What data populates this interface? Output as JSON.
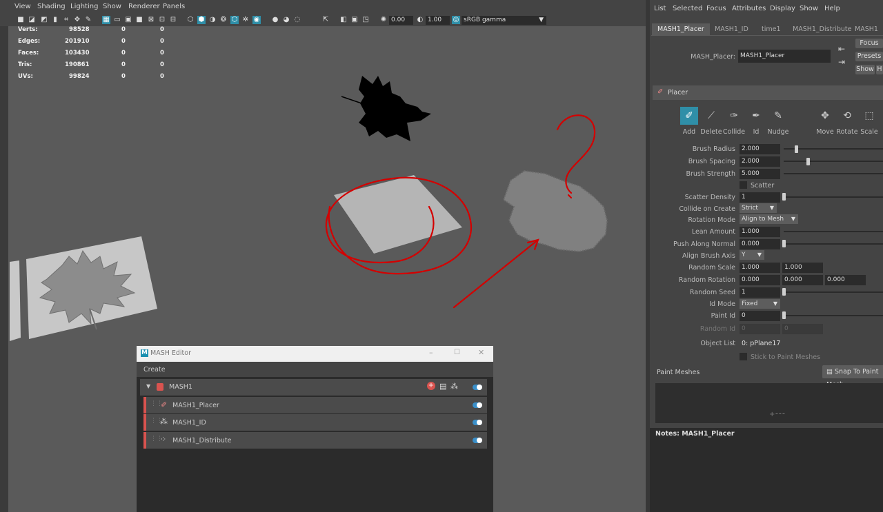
{
  "viewport": {
    "menu": [
      "View",
      "Shading",
      "Lighting",
      "Show",
      "Renderer",
      "Panels"
    ],
    "toolbar": {
      "exposure_value": "0.00",
      "gamma_value": "1.00",
      "color_space": "sRGB gamma"
    },
    "hud": {
      "rows": [
        {
          "label": "Verts:",
          "v1": "98528",
          "v2": "0",
          "v3": "0"
        },
        {
          "label": "Edges:",
          "v1": "201910",
          "v2": "0",
          "v3": "0"
        },
        {
          "label": "Faces:",
          "v1": "103430",
          "v2": "0",
          "v3": "0"
        },
        {
          "label": "Tris:",
          "v1": "190861",
          "v2": "0",
          "v3": "0"
        },
        {
          "label": "UVs:",
          "v1": "99824",
          "v2": "0",
          "v3": "0"
        }
      ]
    }
  },
  "attr_editor": {
    "menu": [
      "List",
      "Selected",
      "Focus",
      "Attributes",
      "Display",
      "Show",
      "Help"
    ],
    "tabs": [
      "MASH1_Placer",
      "MASH1_ID",
      "time1",
      "MASH1_Distribute",
      "MASH1"
    ],
    "node_label": "MASH_Placer:",
    "node_name": "MASH1_Placer",
    "buttons": {
      "focus": "Focus",
      "presets": "Presets",
      "show": "Show",
      "hide": "H"
    },
    "section_title": "Placer",
    "brush_tools": [
      "Add",
      "Delete",
      "Collide",
      "Id",
      "Nudge"
    ],
    "transform_tools": [
      "Move",
      "Rotate",
      "Scale"
    ],
    "brush_radius": {
      "label": "Brush Radius",
      "value": "2.000"
    },
    "brush_spacing": {
      "label": "Brush Spacing",
      "value": "2.000"
    },
    "brush_strength": {
      "label": "Brush Strength",
      "value": "5.000"
    },
    "scatter_label": "Scatter",
    "scatter_density": {
      "label": "Scatter Density",
      "value": "1"
    },
    "collide_on_create": {
      "label": "Collide on Create",
      "value": "Strict"
    },
    "rotation_mode": {
      "label": "Rotation Mode",
      "value": "Align to Mesh"
    },
    "lean_amount": {
      "label": "Lean Amount",
      "value": "1.000"
    },
    "push_along_normal": {
      "label": "Push Along Normal",
      "value": "0.000"
    },
    "align_brush_axis": {
      "label": "Align Brush Axis",
      "value": "Y"
    },
    "random_scale": {
      "label": "Random Scale",
      "v1": "1.000",
      "v2": "1.000"
    },
    "random_rotation": {
      "label": "Random Rotation",
      "v1": "0.000",
      "v2": "0.000",
      "v3": "0.000"
    },
    "random_seed": {
      "label": "Random Seed",
      "value": "1"
    },
    "id_mode": {
      "label": "Id Mode",
      "value": "Fixed"
    },
    "paint_id": {
      "label": "Paint Id",
      "value": "0"
    },
    "random_id": {
      "label": "Random Id",
      "v1": "0",
      "v2": "0"
    },
    "object_list": {
      "label": "Object List",
      "value": "0: pPlane17"
    },
    "stick_label": "Stick to Paint Meshes",
    "paint_meshes_label": "Paint Meshes",
    "snap_button": "Snap To Paint Mesh",
    "notes_label": "Notes:  MASH1_Placer"
  },
  "mash_editor": {
    "title": "MASH Editor",
    "menu_create": "Create",
    "nodes": [
      {
        "name": "MASH1"
      },
      {
        "name": "MASH1_Placer"
      },
      {
        "name": "MASH1_ID"
      },
      {
        "name": "MASH1_Distribute"
      }
    ]
  },
  "colors": {
    "accent": "#2f8fa8",
    "annotation_red": "#d40000",
    "mash_red": "#d9534f",
    "toggle_blue": "#3a8fc9"
  }
}
